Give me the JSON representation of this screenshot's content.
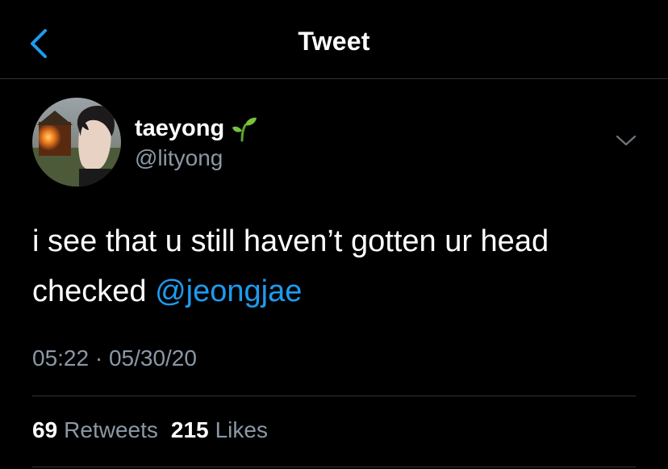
{
  "header": {
    "title": "Tweet",
    "back_icon": "chevron-left-icon"
  },
  "tweet": {
    "author": {
      "display_name": "taeyong",
      "name_emoji": "sprout-icon",
      "handle": "@lityong"
    },
    "text": {
      "line1": "i see that u still haven’t gotten ur head",
      "line2_prefix": "checked ",
      "mention": "@jeongjae"
    },
    "timestamp": "05:22 · 05/30/20",
    "stats": {
      "retweets_count": "69",
      "retweets_label": "Retweets",
      "likes_count": "215",
      "likes_label": "Likes"
    }
  },
  "colors": {
    "background": "#000000",
    "text_primary": "#ffffff",
    "text_secondary": "#8b98a5",
    "accent": "#1d9bf0",
    "divider": "#2f3336"
  }
}
